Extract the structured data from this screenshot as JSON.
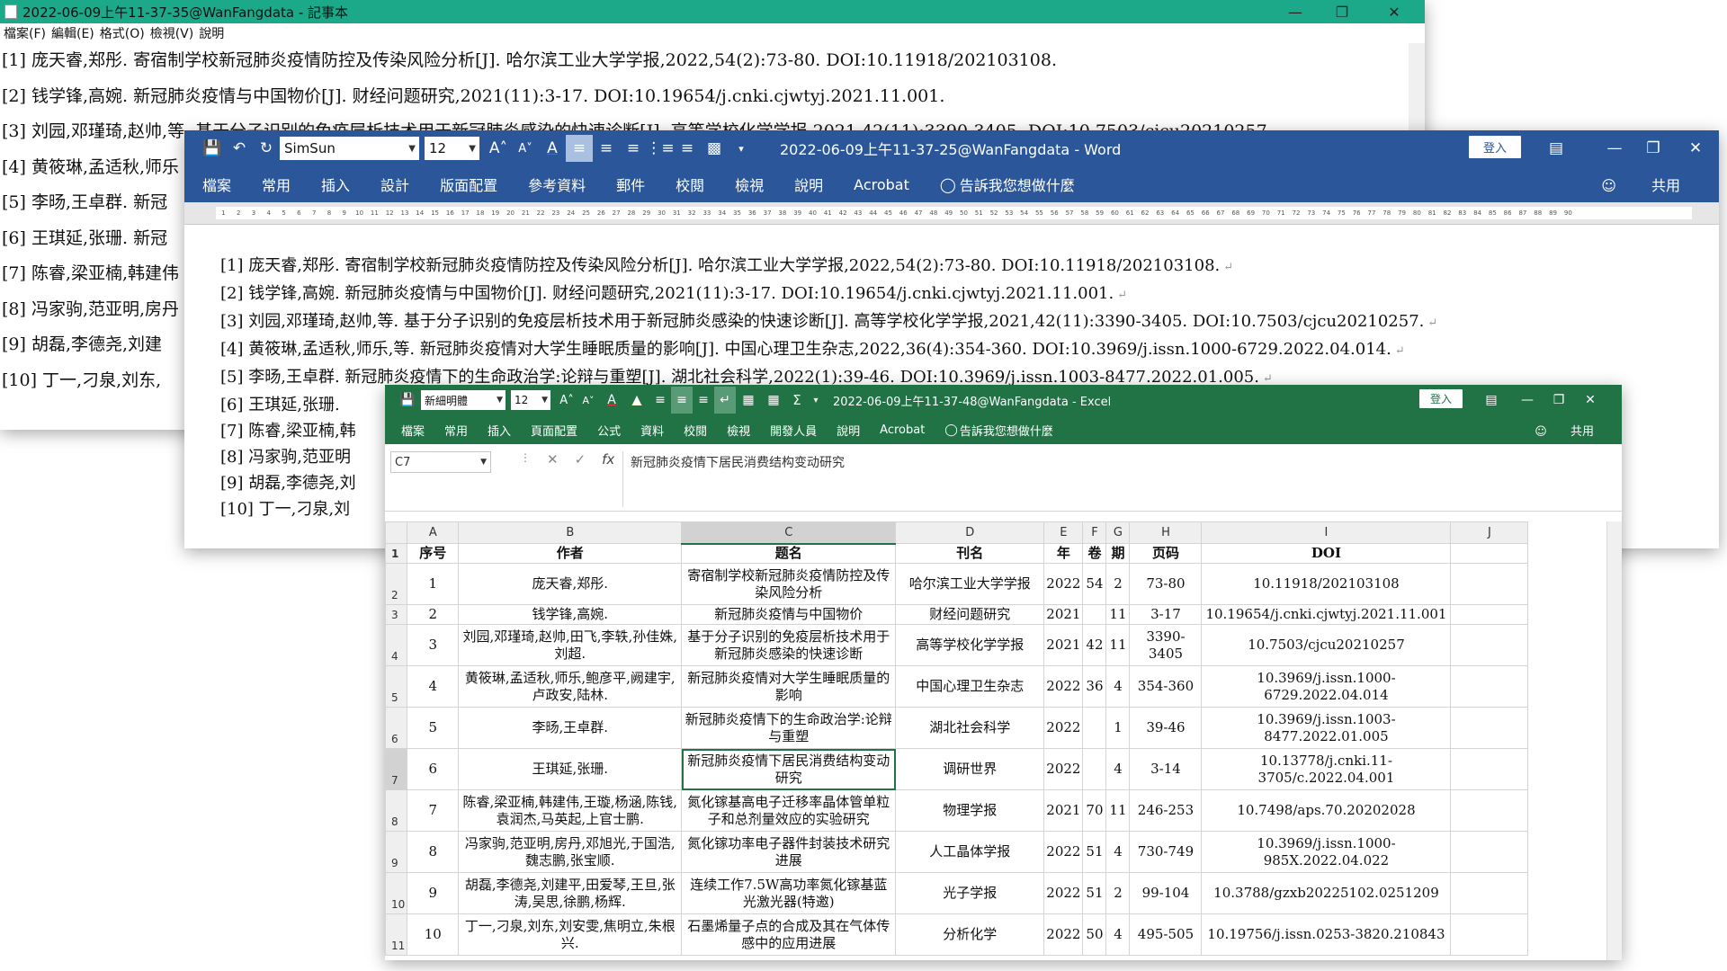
{
  "notepad": {
    "title": "2022-06-09上午11-37-35@WanFangdata - 記事本",
    "menu": [
      "檔案(F)",
      "編輯(E)",
      "格式(O)",
      "檢視(V)",
      "說明"
    ],
    "lines": [
      "[1] 庞天睿,郑彤. 寄宿制学校新冠肺炎疫情防控及传染风险分析[J]. 哈尔滨工业大学学报,2022,54(2):73-80. DOI:10.11918/202103108.",
      "[2] 钱学锋,高婉. 新冠肺炎疫情与中国物价[J]. 财经问题研究,2021(11):3-17. DOI:10.19654/j.cnki.cjwtyj.2021.11.001.",
      "[3] 刘园,邓瑾琦,赵帅,等. 基于分子识别的免疫层析技术用于新冠肺炎感染的快速诊断[J]. 高等学校化学学报,2021,42(11):3390-3405. DOI:10.7503/cjcu20210257.",
      "[4] 黄筱琳,孟适秋,师乐",
      "[5] 李旸,王卓群. 新冠",
      "[6] 王琪延,张珊. 新冠",
      "[7] 陈睿,梁亚楠,韩建伟",
      "[8] 冯家驹,范亚明,房丹",
      "[9] 胡磊,李德尧,刘建",
      "[10] 丁一,刁泉,刘东,"
    ]
  },
  "word": {
    "title": "2022-06-09上午11-37-25@WanFangdata - Word",
    "font": "SimSun",
    "size": "12",
    "signin": "登入",
    "tabs": [
      "檔案",
      "常用",
      "插入",
      "設計",
      "版面配置",
      "參考資料",
      "郵件",
      "校閱",
      "檢視",
      "說明",
      "Acrobat"
    ],
    "tellme": "告訴我您想做什麼",
    "share": "共用",
    "lines": [
      "[1] 庞天睿,郑彤. 寄宿制学校新冠肺炎疫情防控及传染风险分析[J]. 哈尔滨工业大学学报,2022,54(2):73-80. DOI:10.11918/202103108.",
      "[2] 钱学锋,高婉. 新冠肺炎疫情与中国物价[J]. 财经问题研究,2021(11):3-17. DOI:10.19654/j.cnki.cjwtyj.2021.11.001.",
      "[3] 刘园,邓瑾琦,赵帅,等. 基于分子识别的免疫层析技术用于新冠肺炎感染的快速诊断[J]. 高等学校化学学报,2021,42(11):3390-3405. DOI:10.7503/cjcu20210257.",
      "[4] 黄筱琳,孟适秋,师乐,等. 新冠肺炎疫情对大学生睡眠质量的影响[J]. 中国心理卫生杂志,2022,36(4):354-360. DOI:10.3969/j.issn.1000-6729.2022.04.014.",
      "[5] 李旸,王卓群. 新冠肺炎疫情下的生命政治学:论辩与重塑[J]. 湖北社会科学,2022(1):39-46. DOI:10.3969/j.issn.1003-8477.2022.01.005.",
      "[6] 王琪延,张珊.",
      "[7] 陈睿,梁亚楠,韩",
      "[8] 冯家驹,范亚明",
      "[9] 胡磊,李德尧,刘",
      "[10] 丁一,刁泉,刘"
    ]
  },
  "excel": {
    "title": "2022-06-09上午11-37-48@WanFangdata - Excel",
    "font": "新細明體",
    "size": "12",
    "signin": "登入",
    "tabs": [
      "檔案",
      "常用",
      "插入",
      "頁面配置",
      "公式",
      "資料",
      "校閱",
      "檢視",
      "開發人員",
      "說明",
      "Acrobat"
    ],
    "tellme": "告訴我您想做什麼",
    "share": "共用",
    "namebox": "C7",
    "formula": "新冠肺炎疫情下居民消费结构变动研究",
    "columns": [
      "A",
      "B",
      "C",
      "D",
      "E",
      "F",
      "G",
      "H",
      "I",
      "J"
    ],
    "header": [
      "序号",
      "作者",
      "题名",
      "刊名",
      "年",
      "卷",
      "期",
      "页码",
      "DOI",
      ""
    ],
    "rows": [
      [
        "1",
        "庞天睿,郑彤.",
        "寄宿制学校新冠肺炎疫情防控及传染风险分析",
        "哈尔滨工业大学学报",
        "2022",
        "54",
        "2",
        "73-80",
        "10.11918/202103108",
        ""
      ],
      [
        "2",
        "钱学锋,高婉.",
        "新冠肺炎疫情与中国物价",
        "财经问题研究",
        "2021",
        "",
        "11",
        "3-17",
        "10.19654/j.cnki.cjwtyj.2021.11.001",
        ""
      ],
      [
        "3",
        "刘园,邓瑾琦,赵帅,田飞,李轶,孙佳姝,刘超.",
        "基于分子识别的免疫层析技术用于新冠肺炎感染的快速诊断",
        "高等学校化学学报",
        "2021",
        "42",
        "11",
        "3390-3405",
        "10.7503/cjcu20210257",
        ""
      ],
      [
        "4",
        "黄筱琳,孟适秋,师乐,鲍彦平,阙建宇,卢政安,陆林.",
        "新冠肺炎疫情对大学生睡眠质量的影响",
        "中国心理卫生杂志",
        "2022",
        "36",
        "4",
        "354-360",
        "10.3969/j.issn.1000-6729.2022.04.014",
        ""
      ],
      [
        "5",
        "李旸,王卓群.",
        "新冠肺炎疫情下的生命政治学:论辩与重塑",
        "湖北社会科学",
        "2022",
        "",
        "1",
        "39-46",
        "10.3969/j.issn.1003-8477.2022.01.005",
        ""
      ],
      [
        "6",
        "王琪延,张珊.",
        "新冠肺炎疫情下居民消费结构变动研究",
        "调研世界",
        "2022",
        "",
        "4",
        "3-14",
        "10.13778/j.cnki.11-3705/c.2022.04.001",
        ""
      ],
      [
        "7",
        "陈睿,梁亚楠,韩建伟,王璇,杨涵,陈钱,袁润杰,马英起,上官士鹏.",
        "氮化镓基高电子迁移率晶体管单粒子和总剂量效应的实验研究",
        "物理学报",
        "2021",
        "70",
        "11",
        "246-253",
        "10.7498/aps.70.20202028",
        ""
      ],
      [
        "8",
        "冯家驹,范亚明,房丹,邓旭光,于国浩,魏志鹏,张宝顺.",
        "氮化镓功率电子器件封装技术研究进展",
        "人工晶体学报",
        "2022",
        "51",
        "4",
        "730-749",
        "10.3969/j.issn.1000-985X.2022.04.022",
        ""
      ],
      [
        "9",
        "胡磊,李德尧,刘建平,田爱琴,王旦,张涛,吴思,徐鹏,杨辉.",
        "连续工作7.5W高功率氮化镓基蓝光激光器(特邀)",
        "光子学报",
        "2022",
        "51",
        "2",
        "99-104",
        "10.3788/gzxb20225102.0251209",
        ""
      ],
      [
        "10",
        "丁一,刁泉,刘东,刘安雯,焦明立,朱根兴.",
        "石墨烯量子点的合成及其在气体传感中的应用进展",
        "分析化学",
        "2022",
        "50",
        "4",
        "495-505",
        "10.19756/j.issn.0253-3820.210843",
        ""
      ]
    ],
    "rownums": [
      "1",
      "2",
      "3",
      "4",
      "5",
      "6",
      "7",
      "8",
      "9",
      "10",
      "11"
    ]
  }
}
